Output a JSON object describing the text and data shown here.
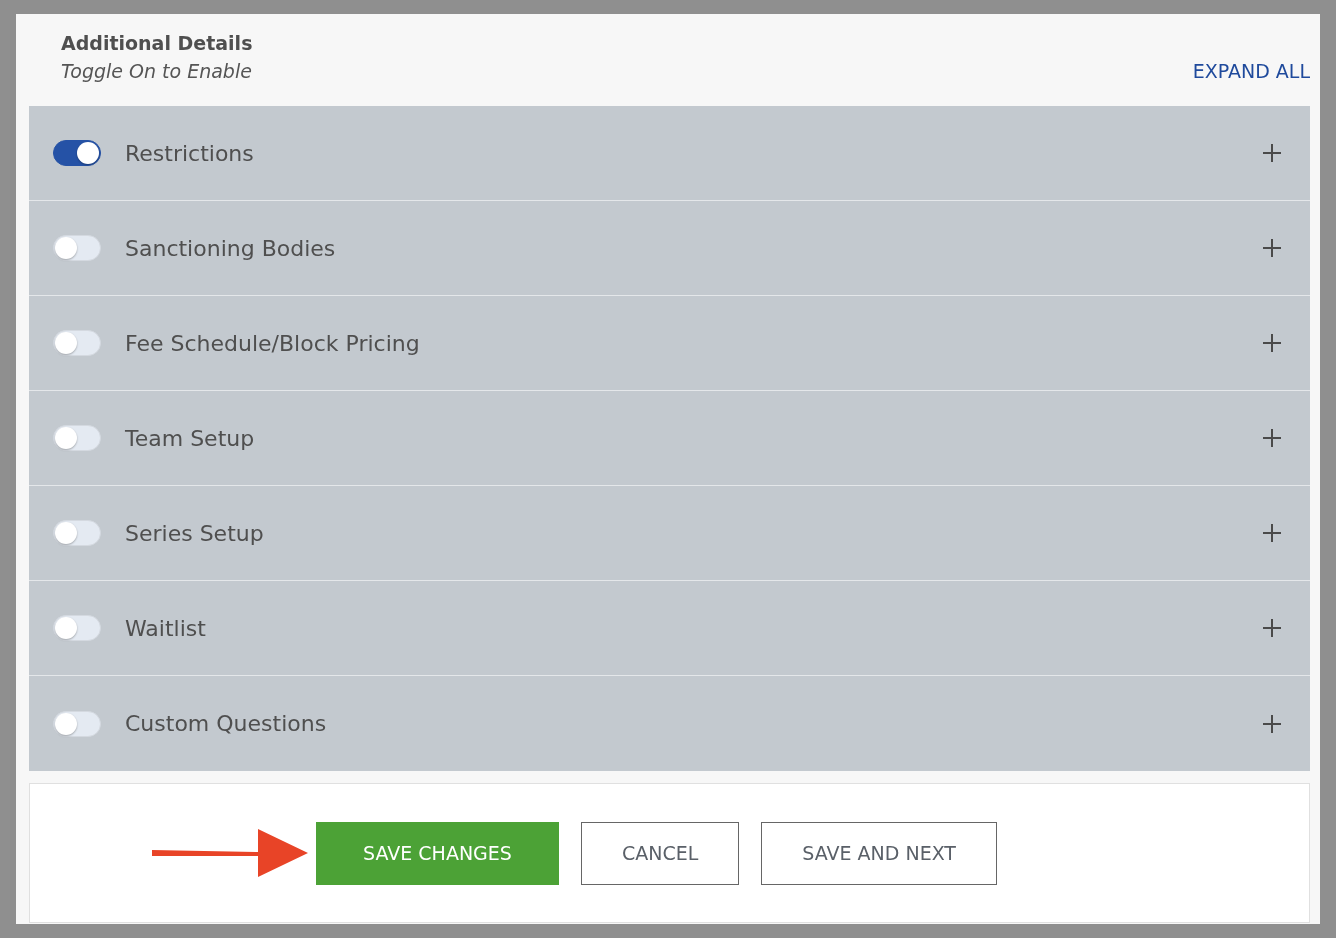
{
  "header": {
    "title": "Additional Details",
    "subtitle": "Toggle On to Enable",
    "expand_all": "EXPAND ALL"
  },
  "sections": [
    {
      "label": "Restrictions",
      "on": true
    },
    {
      "label": "Sanctioning Bodies",
      "on": false
    },
    {
      "label": "Fee Schedule/Block Pricing",
      "on": false
    },
    {
      "label": "Team Setup",
      "on": false
    },
    {
      "label": "Series Setup",
      "on": false
    },
    {
      "label": "Waitlist",
      "on": false
    },
    {
      "label": "Custom Questions",
      "on": false
    }
  ],
  "buttons": [
    {
      "label": "SAVE CHANGES",
      "kind": "primary"
    },
    {
      "label": "CANCEL",
      "kind": "outline"
    },
    {
      "label": "SAVE AND NEXT",
      "kind": "outline"
    }
  ]
}
